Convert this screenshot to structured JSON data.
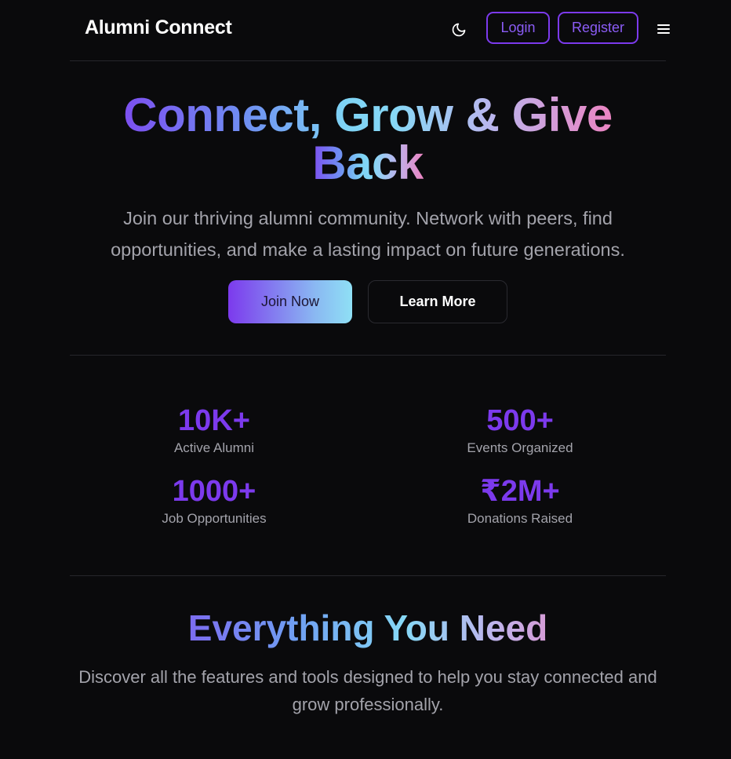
{
  "header": {
    "brand": "Alumni Connect",
    "theme_toggle_icon": "moon-icon",
    "login_label": "Login",
    "register_label": "Register",
    "menu_icon": "hamburger-menu-icon"
  },
  "hero": {
    "title_part_1": "Connect, Grow & Give",
    "title_part_2": "Back",
    "subtitle": "Join our thriving alumni community. Network with peers, find opportunities, and make a lasting impact on future generations.",
    "join_label": "Join Now",
    "learn_label": "Learn More"
  },
  "stats": [
    {
      "value": "10K+",
      "label": "Active Alumni"
    },
    {
      "value": "500+",
      "label": "Events Organized"
    },
    {
      "value": "1000+",
      "label": "Job Opportunities"
    },
    {
      "value": "₹2M+",
      "label": "Donations Raised"
    }
  ],
  "features": {
    "title": "Everything You Need",
    "subtitle": "Discover all the features and tools designed to help you stay connected and grow professionally."
  },
  "colors": {
    "background": "#0a0a0c",
    "accent": "#7c3aed",
    "muted_text": "#a3a3ab"
  }
}
